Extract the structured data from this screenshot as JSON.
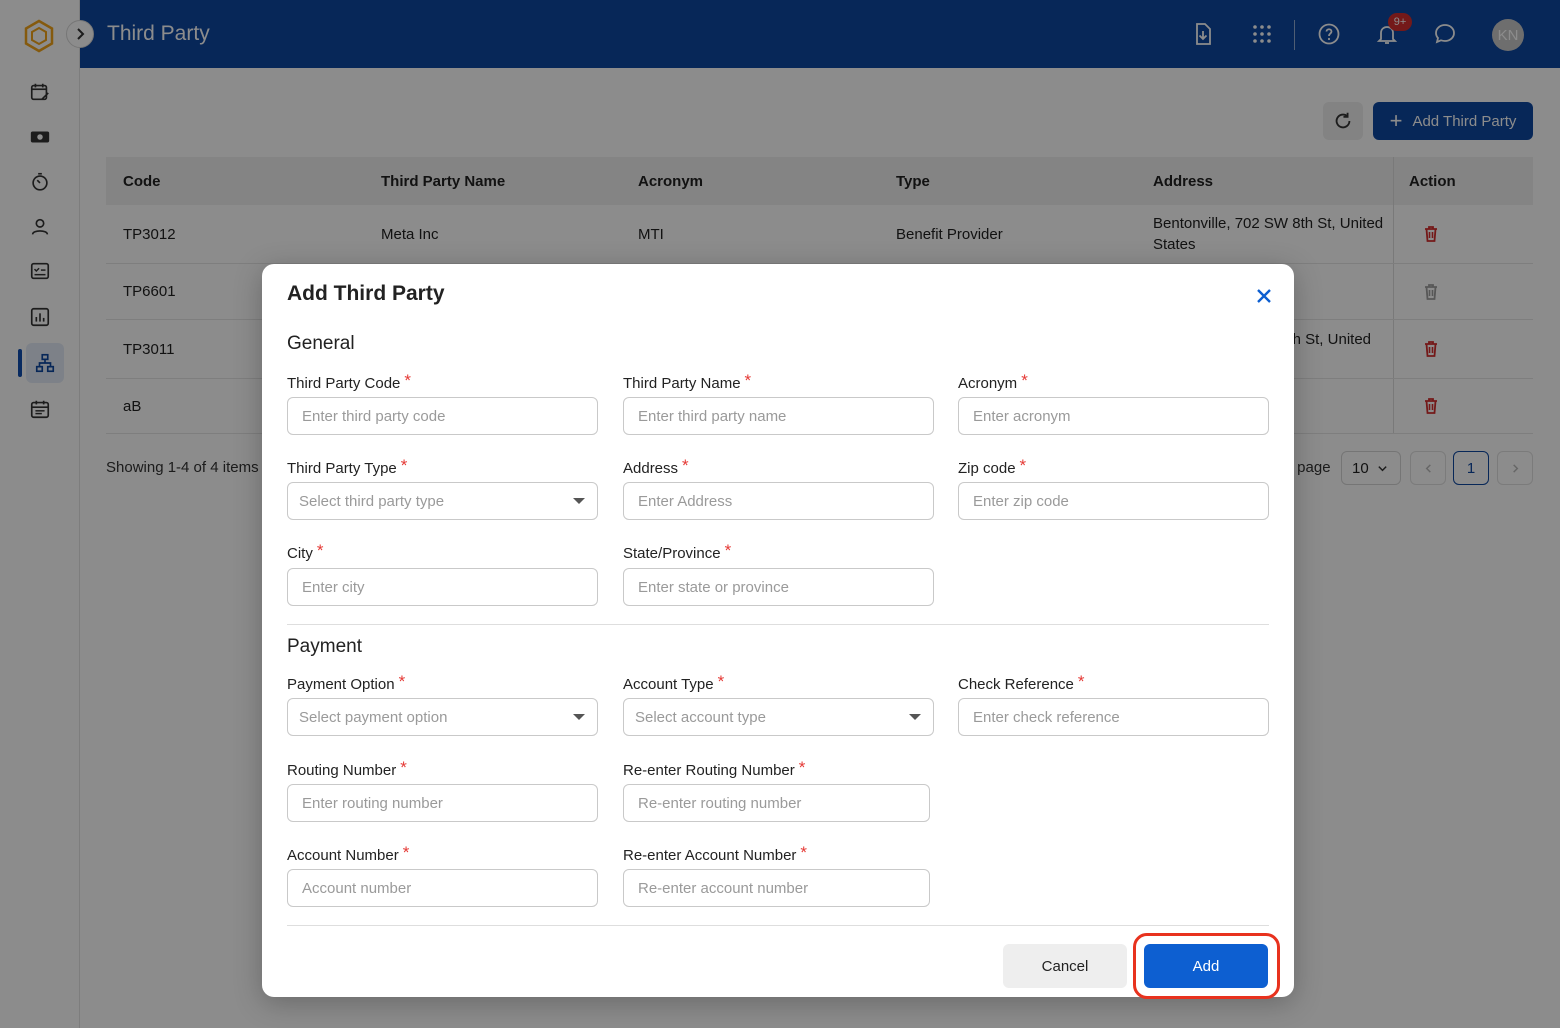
{
  "app": {
    "title": "Third Party"
  },
  "header": {
    "icons": [
      "download-file-icon",
      "apps-grid-icon",
      "help-icon",
      "bell-icon",
      "chat-icon"
    ],
    "notification_badge": "9+",
    "avatar_initials": "KN"
  },
  "sidebar": {
    "items": [
      "calendar-edit-icon",
      "money-icon",
      "timer-icon",
      "person-icon",
      "checklist-icon",
      "bar-chart-icon",
      "org-chart-icon",
      "calendar-icon"
    ],
    "active_item": "org-chart-icon"
  },
  "toolbar": {
    "add_label": "Add Third Party"
  },
  "table": {
    "columns": [
      "Code",
      "Third Party Name",
      "Acronym",
      "Type",
      "Address",
      "Action"
    ],
    "rows": [
      {
        "code": "TP3012",
        "name": "Meta Inc",
        "acronym": "MTI",
        "type": "Benefit Provider",
        "address": "Bentonville, 702 SW 8th St, United States"
      },
      {
        "code": "TP6601",
        "name": "",
        "acronym": "",
        "type": "",
        "address": ""
      },
      {
        "code": "TP3011",
        "name": "",
        "acronym": "",
        "type": "",
        "address": "th St, United"
      },
      {
        "code": "aB",
        "name": "",
        "acronym": "",
        "type": "",
        "address": ""
      }
    ]
  },
  "pagination": {
    "showing": "Showing 1-4 of 4 items",
    "per_page_label": "r page",
    "page_size": "10",
    "current_page": "1"
  },
  "modal": {
    "title": "Add Third Party",
    "general_title": "General",
    "payment_title": "Payment",
    "fields": {
      "code": {
        "label": "Third Party Code",
        "placeholder": "Enter third party code"
      },
      "name": {
        "label": "Third Party Name",
        "placeholder": "Enter third party name"
      },
      "acronym": {
        "label": "Acronym",
        "placeholder": "Enter acronym"
      },
      "type": {
        "label": "Third Party Type",
        "placeholder": "Select third party type"
      },
      "address": {
        "label": "Address",
        "placeholder": "Enter Address"
      },
      "zip": {
        "label": "Zip code",
        "placeholder": "Enter zip code"
      },
      "city": {
        "label": "City",
        "placeholder": "Enter city"
      },
      "state": {
        "label": "State/Province",
        "placeholder": "Enter state or province"
      },
      "payment_option": {
        "label": "Payment Option",
        "placeholder": "Select payment option"
      },
      "account_type": {
        "label": "Account Type",
        "placeholder": "Select account type"
      },
      "check_reference": {
        "label": "Check Reference",
        "placeholder": "Enter check reference"
      },
      "routing": {
        "label": "Routing Number",
        "placeholder": "Enter routing number"
      },
      "routing_confirm": {
        "label": "Re-enter Routing Number",
        "placeholder": "Re-enter routing number"
      },
      "account": {
        "label": "Account Number",
        "placeholder": "Account number"
      },
      "account_confirm": {
        "label": "Re-enter Account Number",
        "placeholder": "Re-enter account number"
      }
    },
    "required_mark": "*",
    "cancel_label": "Cancel",
    "add_label": "Add"
  },
  "colors": {
    "brand": "#0d47a1",
    "primary_button": "#0d5fd1",
    "required": "#e53935",
    "delete": "#d32f2f",
    "highlight": "#e8321e"
  }
}
